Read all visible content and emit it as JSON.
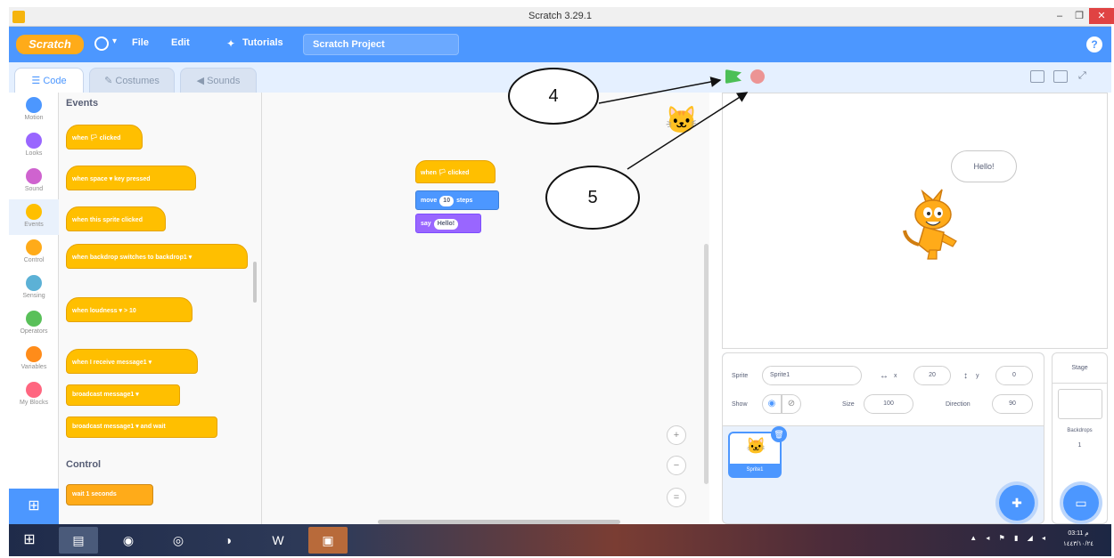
{
  "window": {
    "title": "Scratch 3.29.1",
    "min": "–",
    "max": "❐",
    "close": "✕"
  },
  "menubar": {
    "logo": "Scratch",
    "globe_caret": "▾",
    "file": "File",
    "edit": "Edit",
    "tutorials": "Tutorials",
    "project_title": "Scratch Project",
    "help": "?"
  },
  "tabs": {
    "code": "Code",
    "costumes": "Costumes",
    "sounds": "Sounds"
  },
  "categories": [
    {
      "label": "Motion",
      "color": "#4c97ff"
    },
    {
      "label": "Looks",
      "color": "#9966ff"
    },
    {
      "label": "Sound",
      "color": "#cf63cf"
    },
    {
      "label": "Events",
      "color": "#ffbf00"
    },
    {
      "label": "Control",
      "color": "#ffab19"
    },
    {
      "label": "Sensing",
      "color": "#5cb1d6"
    },
    {
      "label": "Operators",
      "color": "#59c059"
    },
    {
      "label": "Variables",
      "color": "#ff8c1a"
    },
    {
      "label": "My Blocks",
      "color": "#ff6680"
    }
  ],
  "palette": {
    "events_heading": "Events",
    "control_heading": "Control",
    "blocks": [
      "when 🏳 clicked",
      "when space ▾ key pressed",
      "when this sprite clicked",
      "when backdrop switches to backdrop1 ▾",
      "when loudness ▾ > 10",
      "when I receive message1 ▾",
      "broadcast message1 ▾",
      "broadcast message1 ▾ and wait",
      "wait 1 seconds"
    ]
  },
  "script": {
    "hat": "when 🏳 clicked",
    "move_pre": "move",
    "move_value": "10",
    "move_post": "steps",
    "say_pre": "say",
    "say_value": "Hello!"
  },
  "zoom": {
    "in": "+",
    "out": "−",
    "reset": "="
  },
  "stage": {
    "go_tooltip": "Go",
    "bubble": "Hello!"
  },
  "sprite_info": {
    "sprite_label": "Sprite",
    "sprite_name": "Sprite1",
    "x_label": "x",
    "x_value": "20",
    "y_label": "y",
    "y_value": "0",
    "show_label": "Show",
    "size_label": "Size",
    "size_value": "100",
    "direction_label": "Direction",
    "direction_value": "90",
    "thumb_caption": "Sprite1"
  },
  "stage_panel": {
    "title": "Stage",
    "backdrops_label": "Backdrops",
    "backdrops_count": "1"
  },
  "annotations": {
    "a4": "4",
    "a5": "5"
  },
  "taskbar": {
    "clock_time": "03:11 م",
    "clock_date": "١٤٤٣/١٠/٢٤"
  },
  "colors": {
    "brand": "#4c97ff",
    "events": "#ffbf00",
    "motion": "#4c97ff",
    "looks": "#9966ff"
  }
}
